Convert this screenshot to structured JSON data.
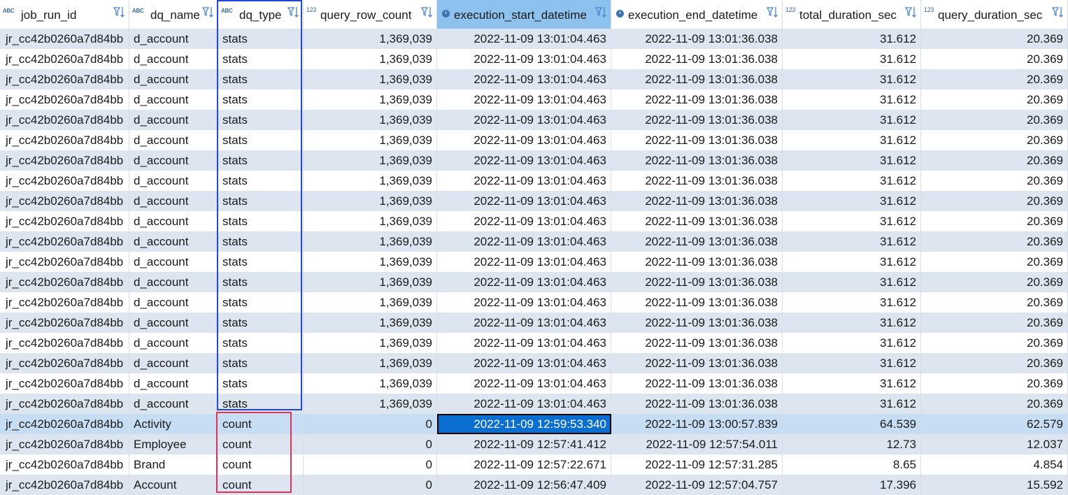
{
  "columns": [
    {
      "label": "job_run_id",
      "type": "text"
    },
    {
      "label": "dq_name",
      "type": "text"
    },
    {
      "label": "dq_type",
      "type": "text"
    },
    {
      "label": "query_row_count",
      "type": "number"
    },
    {
      "label": "execution_start_datetime",
      "type": "datetime"
    },
    {
      "label": "execution_end_datetime",
      "type": "datetime"
    },
    {
      "label": "total_duration_sec",
      "type": "number"
    },
    {
      "label": "query_duration_sec",
      "type": "number"
    }
  ],
  "type_icons": {
    "text": "ABC",
    "number": "123",
    "datetime": "clock-icon"
  },
  "rows": [
    [
      "jr_cc42b0260a7d84bb",
      "d_account",
      "stats",
      "1,369,039",
      "2022-11-09 13:01:04.463",
      "2022-11-09 13:01:36.038",
      "31.612",
      "20.369"
    ],
    [
      "jr_cc42b0260a7d84bb",
      "d_account",
      "stats",
      "1,369,039",
      "2022-11-09 13:01:04.463",
      "2022-11-09 13:01:36.038",
      "31.612",
      "20.369"
    ],
    [
      "jr_cc42b0260a7d84bb",
      "d_account",
      "stats",
      "1,369,039",
      "2022-11-09 13:01:04.463",
      "2022-11-09 13:01:36.038",
      "31.612",
      "20.369"
    ],
    [
      "jr_cc42b0260a7d84bb",
      "d_account",
      "stats",
      "1,369,039",
      "2022-11-09 13:01:04.463",
      "2022-11-09 13:01:36.038",
      "31.612",
      "20.369"
    ],
    [
      "jr_cc42b0260a7d84bb",
      "d_account",
      "stats",
      "1,369,039",
      "2022-11-09 13:01:04.463",
      "2022-11-09 13:01:36.038",
      "31.612",
      "20.369"
    ],
    [
      "jr_cc42b0260a7d84bb",
      "d_account",
      "stats",
      "1,369,039",
      "2022-11-09 13:01:04.463",
      "2022-11-09 13:01:36.038",
      "31.612",
      "20.369"
    ],
    [
      "jr_cc42b0260a7d84bb",
      "d_account",
      "stats",
      "1,369,039",
      "2022-11-09 13:01:04.463",
      "2022-11-09 13:01:36.038",
      "31.612",
      "20.369"
    ],
    [
      "jr_cc42b0260a7d84bb",
      "d_account",
      "stats",
      "1,369,039",
      "2022-11-09 13:01:04.463",
      "2022-11-09 13:01:36.038",
      "31.612",
      "20.369"
    ],
    [
      "jr_cc42b0260a7d84bb",
      "d_account",
      "stats",
      "1,369,039",
      "2022-11-09 13:01:04.463",
      "2022-11-09 13:01:36.038",
      "31.612",
      "20.369"
    ],
    [
      "jr_cc42b0260a7d84bb",
      "d_account",
      "stats",
      "1,369,039",
      "2022-11-09 13:01:04.463",
      "2022-11-09 13:01:36.038",
      "31.612",
      "20.369"
    ],
    [
      "jr_cc42b0260a7d84bb",
      "d_account",
      "stats",
      "1,369,039",
      "2022-11-09 13:01:04.463",
      "2022-11-09 13:01:36.038",
      "31.612",
      "20.369"
    ],
    [
      "jr_cc42b0260a7d84bb",
      "d_account",
      "stats",
      "1,369,039",
      "2022-11-09 13:01:04.463",
      "2022-11-09 13:01:36.038",
      "31.612",
      "20.369"
    ],
    [
      "jr_cc42b0260a7d84bb",
      "d_account",
      "stats",
      "1,369,039",
      "2022-11-09 13:01:04.463",
      "2022-11-09 13:01:36.038",
      "31.612",
      "20.369"
    ],
    [
      "jr_cc42b0260a7d84bb",
      "d_account",
      "stats",
      "1,369,039",
      "2022-11-09 13:01:04.463",
      "2022-11-09 13:01:36.038",
      "31.612",
      "20.369"
    ],
    [
      "jr_cc42b0260a7d84bb",
      "d_account",
      "stats",
      "1,369,039",
      "2022-11-09 13:01:04.463",
      "2022-11-09 13:01:36.038",
      "31.612",
      "20.369"
    ],
    [
      "jr_cc42b0260a7d84bb",
      "d_account",
      "stats",
      "1,369,039",
      "2022-11-09 13:01:04.463",
      "2022-11-09 13:01:36.038",
      "31.612",
      "20.369"
    ],
    [
      "jr_cc42b0260a7d84bb",
      "d_account",
      "stats",
      "1,369,039",
      "2022-11-09 13:01:04.463",
      "2022-11-09 13:01:36.038",
      "31.612",
      "20.369"
    ],
    [
      "jr_cc42b0260a7d84bb",
      "d_account",
      "stats",
      "1,369,039",
      "2022-11-09 13:01:04.463",
      "2022-11-09 13:01:36.038",
      "31.612",
      "20.369"
    ],
    [
      "jr_cc42b0260a7d84bb",
      "d_account",
      "stats",
      "1,369,039",
      "2022-11-09 13:01:04.463",
      "2022-11-09 13:01:36.038",
      "31.612",
      "20.369"
    ],
    [
      "jr_cc42b0260a7d84bb",
      "Activity",
      "count",
      "0",
      "2022-11-09 12:59:53.340",
      "2022-11-09 13:00:57.839",
      "64.539",
      "62.579"
    ],
    [
      "jr_cc42b0260a7d84bb",
      "Employee",
      "count",
      "0",
      "2022-11-09 12:57:41.412",
      "2022-11-09 12:57:54.011",
      "12.73",
      "12.037"
    ],
    [
      "jr_cc42b0260a7d84bb",
      "Brand",
      "count",
      "0",
      "2022-11-09 12:57:22.671",
      "2022-11-09 12:57:31.285",
      "8.65",
      "4.854"
    ],
    [
      "jr_cc42b0260a7d84bb",
      "Account",
      "count",
      "0",
      "2022-11-09 12:56:47.409",
      "2022-11-09 12:57:04.757",
      "17.396",
      "15.592"
    ]
  ],
  "sorted_column": 4,
  "selected_row": 19,
  "focused_cell": {
    "row": 19,
    "col": 4
  },
  "colors": {
    "row_stripe": "#dde5f0",
    "selected_row": "#c6ddf3",
    "sorted_header": "#8dc1ee",
    "focused_cell": "#0a6fd1",
    "highlight_blue": "#2446d8",
    "highlight_red": "#e0325a"
  }
}
